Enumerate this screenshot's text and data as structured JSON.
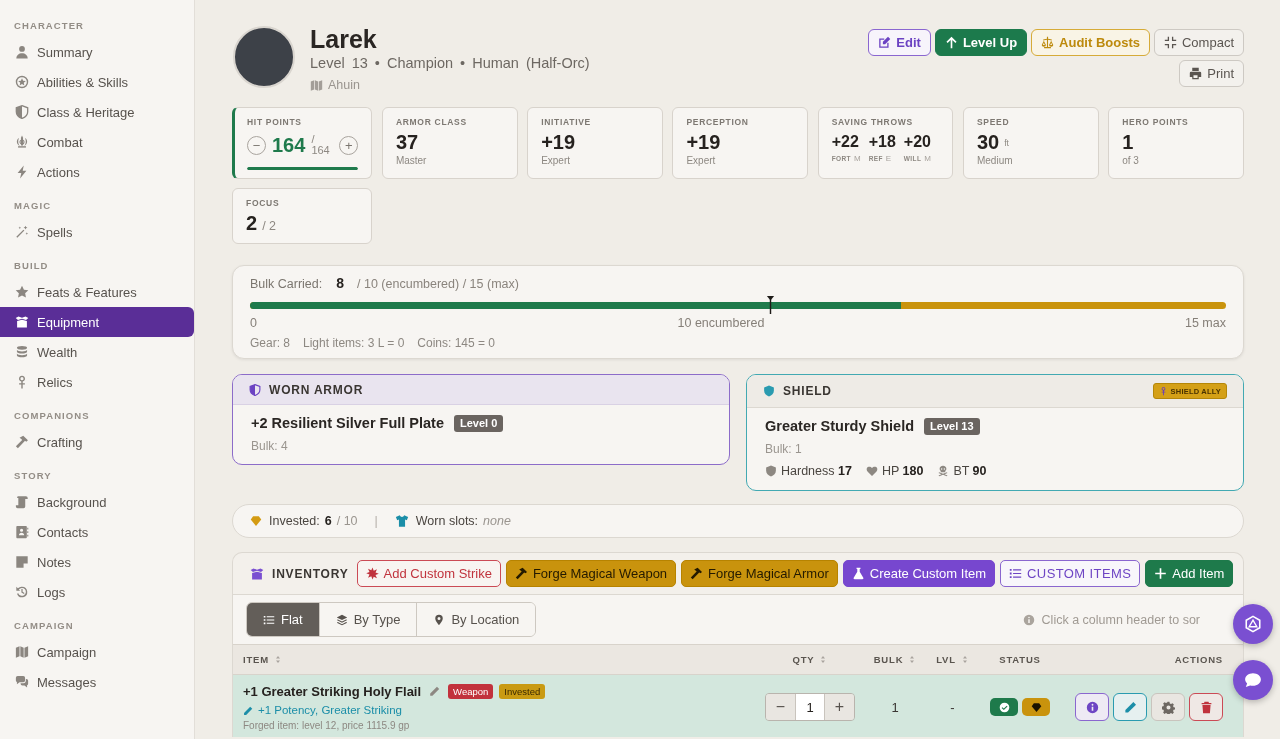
{
  "sidebar": {
    "sections": [
      {
        "heading": "CHARACTER",
        "items": [
          {
            "label": "Summary",
            "selected": false
          },
          {
            "label": "Abilities & Skills",
            "selected": false
          },
          {
            "label": "Class & Heritage",
            "selected": false
          },
          {
            "label": "Combat",
            "selected": false
          },
          {
            "label": "Actions",
            "selected": false
          }
        ]
      },
      {
        "heading": "MAGIC",
        "items": [
          {
            "label": "Spells",
            "selected": false
          }
        ]
      },
      {
        "heading": "BUILD",
        "items": [
          {
            "label": "Feats & Features",
            "selected": false
          },
          {
            "label": "Equipment",
            "selected": true
          },
          {
            "label": "Wealth",
            "selected": false
          },
          {
            "label": "Relics",
            "selected": false
          }
        ]
      },
      {
        "heading": "COMPANIONS",
        "items": [
          {
            "label": "Crafting",
            "selected": false
          }
        ]
      },
      {
        "heading": "STORY",
        "items": [
          {
            "label": "Background",
            "selected": false
          },
          {
            "label": "Contacts",
            "selected": false
          },
          {
            "label": "Notes",
            "selected": false
          },
          {
            "label": "Logs",
            "selected": false
          }
        ]
      },
      {
        "heading": "CAMPAIGN",
        "items": [
          {
            "label": "Campaign",
            "selected": false
          },
          {
            "label": "Messages",
            "selected": false
          }
        ]
      }
    ]
  },
  "header": {
    "name": "Larek",
    "subtitle": "Level 13 • Champion • Human (Half-Orc)",
    "campaign": "Ahuin",
    "buttons": [
      {
        "label": "Edit",
        "kind": "edit"
      },
      {
        "label": "Level Up",
        "kind": "level"
      },
      {
        "label": "Audit Boosts",
        "kind": "audit"
      },
      {
        "label": "Compact",
        "kind": "plain"
      },
      {
        "label": "Print",
        "kind": "plain"
      }
    ]
  },
  "stats": [
    {
      "kind": "hit_points",
      "label": "HIT POINTS",
      "value": "164",
      "max": "/ 164",
      "decrease": "−",
      "increase": "+",
      "level": 1
    },
    {
      "kind": "stat",
      "label": "ARMOR CLASS",
      "value": "37",
      "sub": "Master"
    },
    {
      "kind": "stat",
      "label": "INITIATIVE",
      "value": "+19",
      "sub": "Expert"
    },
    {
      "kind": "stat",
      "label": "PERCEPTION",
      "value": "+19",
      "sub": "Expert"
    },
    {
      "kind": "saves",
      "label": "SAVING THROWS",
      "saves": [
        {
          "value": "+22",
          "name": "FORT",
          "rank": "M"
        },
        {
          "value": "+18",
          "name": "REF",
          "rank": "E"
        },
        {
          "value": "+20",
          "name": "WILL",
          "rank": "M"
        }
      ]
    },
    {
      "kind": "stat",
      "label": "SPEED",
      "value": "30",
      "unit": "ft",
      "sub": "Medium"
    },
    {
      "kind": "stat",
      "label": "HERO POINTS",
      "value": "1",
      "sub": "of 3"
    },
    {
      "kind": "stat",
      "label": "FOCUS",
      "value": "2",
      "out_of": "/ 2"
    }
  ],
  "bulk": {
    "label": "Bulk Carried:",
    "value": "8",
    "limits": "/ 10 (encumbered) / 15 (max)",
    "fill": {
      "level": 0.667
    },
    "marker": {
      "level": 0.533
    },
    "scale": [
      "0",
      "10 encumbered",
      "15 max"
    ],
    "breakdown": [
      "Gear: 8",
      "Light items: 3 L = 0",
      "Coins: 145 = 0"
    ]
  },
  "armor": {
    "header": "WORN ARMOR",
    "name": "+2 Resilient Silver Full Plate",
    "level_tag": "Level 0",
    "bulk": "Bulk: 4"
  },
  "shield": {
    "header": "SHIELD",
    "badge": "SHIELD ALLY",
    "name": "Greater Sturdy Shield",
    "level_tag": "Level 13",
    "bulk": "Bulk: 1",
    "stats": [
      "Hardness **17**",
      "HP **180**",
      "BT **90**"
    ]
  },
  "invested": {
    "label": "Invested:",
    "value": "6",
    "max": "/ 10",
    "separator": "|",
    "slots_label": "Worn slots:",
    "slots_value": "none"
  },
  "inventory": {
    "title": "INVENTORY",
    "actions": [
      {
        "label": "Add Custom Strike",
        "kind": "danger"
      },
      {
        "label": "Forge Magical Weapon",
        "kind": "forge"
      },
      {
        "label": "Forge Magical Armor",
        "kind": "forge"
      },
      {
        "label": "Create Custom Item",
        "kind": "create"
      },
      {
        "label": "CUSTOM ITEMS",
        "kind": "catalog"
      },
      {
        "label": "Add Item",
        "kind": "add"
      }
    ],
    "views": [
      {
        "label": "Flat",
        "selected": true
      },
      {
        "label": "By Type",
        "selected": false
      },
      {
        "label": "By Location",
        "selected": false
      }
    ],
    "hint": "Click a column header to sor",
    "columns": [
      {
        "label": "ITEM",
        "sortable": true
      },
      {
        "label": "QTY",
        "sortable": true
      },
      {
        "label": "BULK",
        "sortable": true
      },
      {
        "label": "LVL",
        "sortable": true
      },
      {
        "label": "STATUS",
        "sortable": false
      },
      {
        "label": "ACTIONS",
        "sortable": false
      }
    ],
    "rows": [
      {
        "name": "+1 Greater Striking Holy Flail",
        "tags": [
          {
            "label": "Weapon",
            "kind": "category"
          },
          {
            "label": "Invested",
            "kind": "invested"
          }
        ],
        "runes": "+1 Potency, Greater Striking",
        "note": "Forged item: level 12, price 1115.9 gp",
        "qty": "1",
        "qty_decrease": "−",
        "qty_increase": "+",
        "bulk": "1",
        "lvl": "-",
        "equipped": true,
        "invested": true
      }
    ]
  }
}
